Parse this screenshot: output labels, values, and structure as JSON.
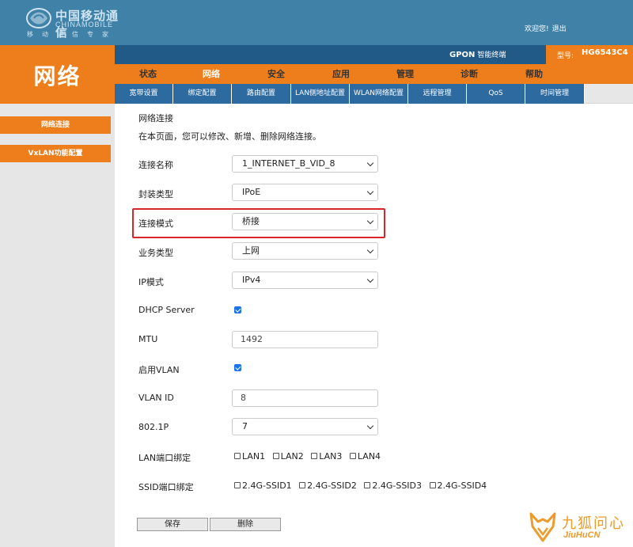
{
  "brand": {
    "name_cn": "中国移动通信",
    "name_en": "CHINAMOBILE",
    "slogan": "移动通信专家"
  },
  "header": {
    "welcome": "欢迎您!",
    "logout": "退出",
    "gpon": "GPON",
    "gpon_sub": "智能终端",
    "model_label": "型号:",
    "model_value": "HG6543C4"
  },
  "page_title": "网络",
  "menu": [
    "状态",
    "网络",
    "安全",
    "应用",
    "管理",
    "诊断",
    "帮助"
  ],
  "menu_active": "网络",
  "subtabs": [
    "宽带设置",
    "绑定配置",
    "路由配置",
    "LAN侧地址配置",
    "WLAN网络配置",
    "远程管理",
    "QoS",
    "时间管理"
  ],
  "sidebar": [
    "网络连接",
    "VxLAN功能配置"
  ],
  "content": {
    "heading": "网络连接",
    "description": "在本页面，您可以修改、新增、删除网络连接。",
    "fields": {
      "conn_name": {
        "label": "连接名称",
        "value": "1_INTERNET_B_VID_8"
      },
      "encap": {
        "label": "封装类型",
        "value": "IPoE"
      },
      "conn_mode": {
        "label": "连接模式",
        "value": "桥接"
      },
      "service": {
        "label": "业务类型",
        "value": "上网"
      },
      "ip_mode": {
        "label": "IP模式",
        "value": "IPv4"
      },
      "dhcp": {
        "label": "DHCP Server",
        "checked": true
      },
      "mtu": {
        "label": "MTU",
        "value": "1492"
      },
      "vlan_enable": {
        "label": "启用VLAN",
        "checked": true
      },
      "vlan_id": {
        "label": "VLAN ID",
        "value": "8"
      },
      "dot1p": {
        "label": "802.1P",
        "value": "7"
      },
      "lan_bind": {
        "label": "LAN端口绑定",
        "options": [
          "LAN1",
          "LAN2",
          "LAN3",
          "LAN4"
        ]
      },
      "ssid_bind": {
        "label": "SSID端口绑定",
        "options": [
          "2.4G-SSID1",
          "2.4G-SSID2",
          "2.4G-SSID3",
          "2.4G-SSID4"
        ]
      }
    },
    "buttons": {
      "save": "保存",
      "delete": "删除"
    }
  },
  "watermark": {
    "cn": "九狐问心",
    "en": "JiuHuCN"
  },
  "colors": {
    "orange": "#ee7e1b",
    "header_blue": "#3f81a7",
    "dark_blue": "#225a87",
    "tab_blue": "#2c6aa0",
    "highlight_red": "#d7262c"
  }
}
